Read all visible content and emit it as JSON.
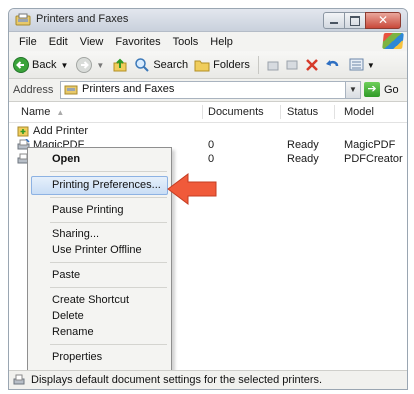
{
  "window": {
    "title": "Printers and Faxes"
  },
  "menubar": {
    "items": [
      "File",
      "Edit",
      "View",
      "Favorites",
      "Tools",
      "Help"
    ]
  },
  "toolbar": {
    "back_label": "Back",
    "search_label": "Search",
    "folders_label": "Folders"
  },
  "addressbar": {
    "label": "Address",
    "value": "Printers and Faxes",
    "go_label": "Go"
  },
  "list": {
    "columns": [
      "Name",
      "Documents",
      "Status",
      "Model"
    ],
    "rows": [
      {
        "name": "Add Printer",
        "documents": "",
        "status": "",
        "model": ""
      },
      {
        "name": "MagicPDF",
        "documents": "0",
        "status": "Ready",
        "model": "MagicPDF"
      },
      {
        "name": "",
        "documents": "0",
        "status": "Ready",
        "model": "PDFCreator"
      }
    ]
  },
  "context_menu": {
    "items": [
      "Open",
      "Printing Preferences...",
      "Pause Printing",
      "Sharing...",
      "Use Printer Offline",
      "Paste",
      "Create Shortcut",
      "Delete",
      "Rename",
      "Properties"
    ],
    "highlighted": "Printing Preferences..."
  },
  "statusbar": {
    "text": "Displays default document settings for the selected printers."
  },
  "colors": {
    "arrow": "#f05a3a",
    "highlight": "#c9ddf5",
    "go_green": "#2f9a26"
  }
}
